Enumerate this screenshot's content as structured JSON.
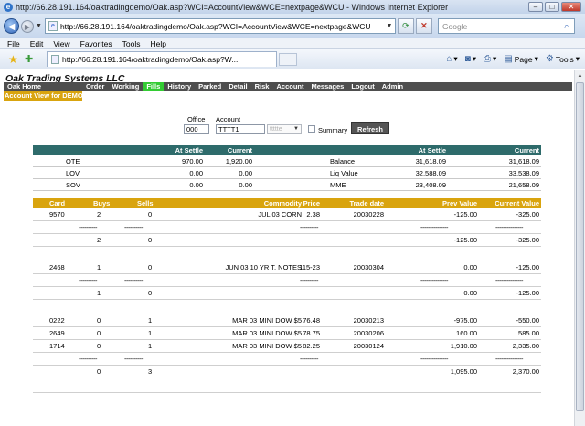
{
  "browser": {
    "window_title": "http://66.28.191.164/oaktradingdemo/Oak.asp?WCI=AccountView&WCE=nextpage&WCU - Windows Internet Explorer",
    "address": "http://66.28.191.164/oaktradingdemo/Oak.asp?WCI=AccountView&WCE=nextpage&WCU",
    "search_placeholder": "Google",
    "menu": [
      "File",
      "Edit",
      "View",
      "Favorites",
      "Tools",
      "Help"
    ],
    "tab_title": "http://66.28.191.164/oaktradingdemo/Oak.asp?W...",
    "commands": {
      "page": "Page",
      "tools": "Tools"
    }
  },
  "app": {
    "brand": "Oak Trading Systems LLC",
    "nav": [
      "Oak Home",
      "Order",
      "Working",
      "Fills",
      "History",
      "Parked",
      "Detail",
      "Risk",
      "Account",
      "Messages",
      "Logout",
      "Admin"
    ],
    "active_nav": "Fills",
    "subtitle": "Account View for DEMO"
  },
  "filters": {
    "office_label": "Office",
    "office_value": "000",
    "account_label": "Account",
    "account_value": "TTTT1",
    "trader_value": "ttttte",
    "summary_label": "Summary",
    "refresh_label": "Refresh"
  },
  "summary": {
    "headers": {
      "at_settle": "At Settle",
      "current": "Current",
      "at_settle_2": "At Settle",
      "current_2": "Current"
    },
    "rows": [
      {
        "label": "OTE",
        "at_settle": "970.00",
        "current": "1,920.00",
        "label2": "Balance",
        "at_settle2": "31,618.09",
        "current2": "31,618.09"
      },
      {
        "label": "LOV",
        "at_settle": "0.00",
        "current": "0.00",
        "label2": "Liq Value",
        "at_settle2": "32,588.09",
        "current2": "33,538.09"
      },
      {
        "label": "SOV",
        "at_settle": "0.00",
        "current": "0.00",
        "label2": "MME",
        "at_settle2": "23,408.09",
        "current2": "21,658.09"
      }
    ]
  },
  "trades": {
    "headers": {
      "card": "Card",
      "buys": "Buys",
      "sells": "Sells",
      "commodity": "Commodity",
      "price": "Price",
      "trade_date": "Trade date",
      "prev_value": "Prev Value",
      "current_value": "Current Value"
    },
    "rows": [
      {
        "card": "9570",
        "buys": "2",
        "sells": "0",
        "commodity": "JUL 03 CORN",
        "price": "2.38",
        "trade_date": "20030228",
        "prev_value": "-125.00",
        "current_value": "-325.00"
      },
      {
        "kind": "sep",
        "buys": "----------",
        "sells": "----------",
        "price": "----------",
        "prev_value": "---------------",
        "current_value": "---------------"
      },
      {
        "card": "",
        "buys": "2",
        "sells": "0",
        "commodity": "",
        "price": "",
        "trade_date": "",
        "prev_value": "-125.00",
        "current_value": "-325.00"
      },
      {
        "kind": "blank"
      },
      {
        "card": "2468",
        "buys": "1",
        "sells": "0",
        "commodity": "JUN 03 10 YR T. NOTES",
        "price": "115-23",
        "trade_date": "20030304",
        "prev_value": "0.00",
        "current_value": "-125.00"
      },
      {
        "kind": "sep",
        "buys": "----------",
        "sells": "----------",
        "price": "----------",
        "prev_value": "---------------",
        "current_value": "---------------"
      },
      {
        "card": "",
        "buys": "1",
        "sells": "0",
        "commodity": "",
        "price": "",
        "trade_date": "",
        "prev_value": "0.00",
        "current_value": "-125.00"
      },
      {
        "kind": "blank"
      },
      {
        "card": "0222",
        "buys": "0",
        "sells": "1",
        "commodity": "MAR 03 MINI DOW $5",
        "price": "76.48",
        "trade_date": "20030213",
        "prev_value": "-975.00",
        "current_value": "-550.00"
      },
      {
        "card": "2649",
        "buys": "0",
        "sells": "1",
        "commodity": "MAR 03 MINI DOW $5",
        "price": "78.75",
        "trade_date": "20030206",
        "prev_value": "160.00",
        "current_value": "585.00"
      },
      {
        "card": "1714",
        "buys": "0",
        "sells": "1",
        "commodity": "MAR 03 MINI DOW $5",
        "price": "82.25",
        "trade_date": "20030124",
        "prev_value": "1,910.00",
        "current_value": "2,335.00"
      },
      {
        "kind": "sep",
        "buys": "----------",
        "sells": "----------",
        "price": "----------",
        "prev_value": "---------------",
        "current_value": "---------------"
      },
      {
        "card": "",
        "buys": "0",
        "sells": "3",
        "commodity": "",
        "price": "",
        "trade_date": "",
        "prev_value": "1,095.00",
        "current_value": "2,370.00"
      },
      {
        "kind": "blank"
      }
    ]
  }
}
